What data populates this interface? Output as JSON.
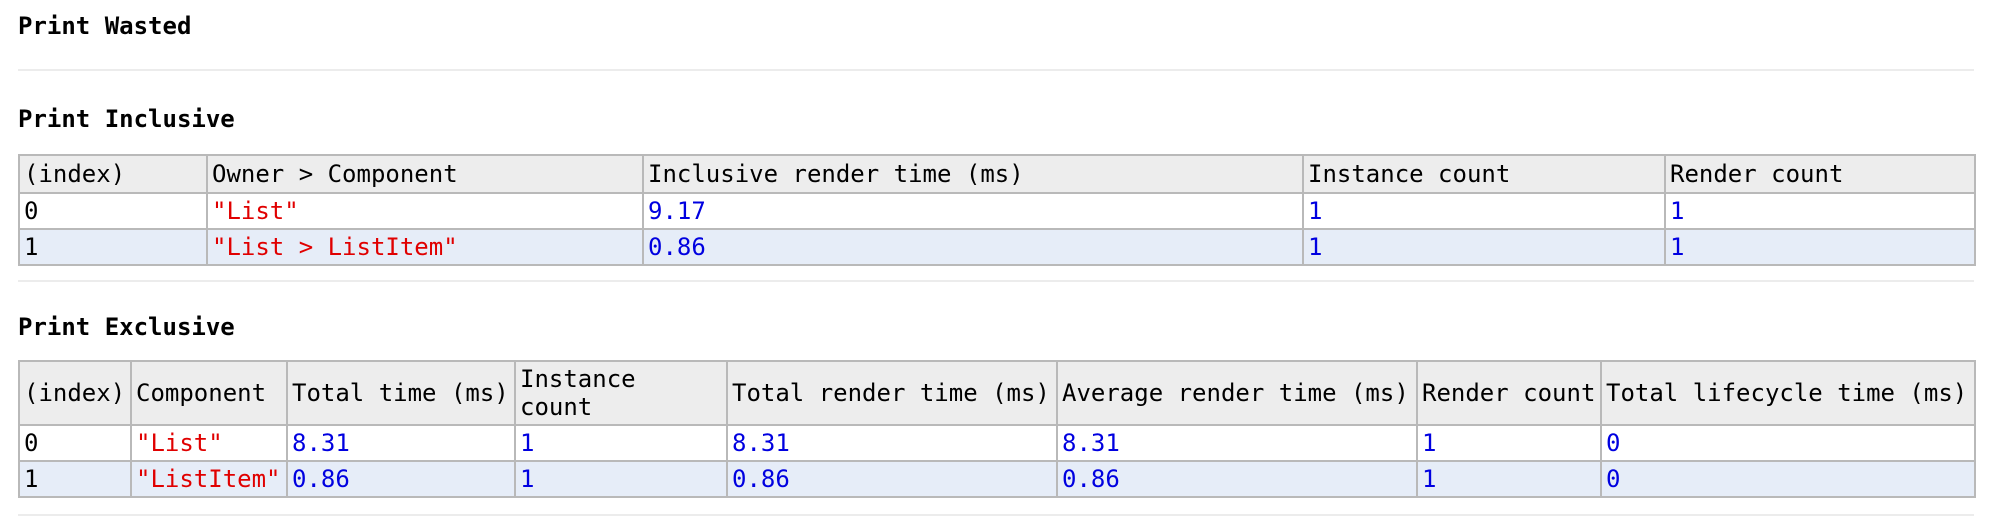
{
  "wasted": {
    "title": "Print Wasted"
  },
  "inclusive": {
    "title": "Print Inclusive",
    "headers": [
      "(index)",
      "Owner > Component",
      "Inclusive render time (ms)",
      "Instance count",
      "Render count"
    ],
    "rows": [
      {
        "index": "0",
        "component": "\"List\"",
        "render_time": "9.17",
        "instance_count": "1",
        "render_count": "1"
      },
      {
        "index": "1",
        "component": "\"List > ListItem\"",
        "render_time": "0.86",
        "instance_count": "1",
        "render_count": "1"
      }
    ]
  },
  "exclusive": {
    "title": "Print Exclusive",
    "headers": [
      "(index)",
      "Component",
      "Total time (ms)",
      "Instance count",
      "Total render time (ms)",
      "Average render time (ms)",
      "Render count",
      "Total lifecycle time (ms)"
    ],
    "rows": [
      {
        "index": "0",
        "component": "\"List\"",
        "total_time": "8.31",
        "instance_count": "1",
        "total_render_time": "8.31",
        "avg_render_time": "8.31",
        "render_count": "1",
        "lifecycle_time": "0"
      },
      {
        "index": "1",
        "component": "\"ListItem\"",
        "total_time": "0.86",
        "instance_count": "1",
        "total_render_time": "0.86",
        "avg_render_time": "0.86",
        "render_count": "1",
        "lifecycle_time": "0"
      }
    ]
  },
  "colors": {
    "string_value": "#e00000",
    "number_value": "#0000e0",
    "header_bg": "#ededed",
    "alt_row_bg": "#e6edf8",
    "border": "#b9b9b9"
  }
}
